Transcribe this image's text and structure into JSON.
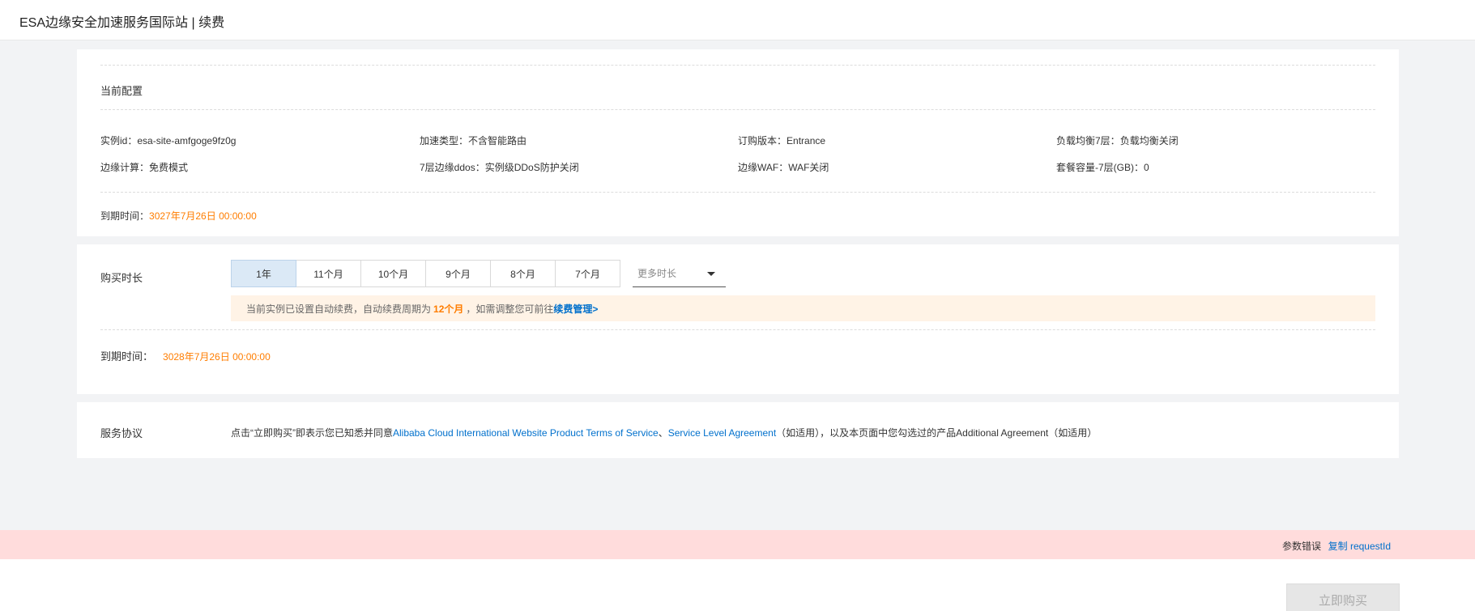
{
  "header": {
    "title": "ESA边缘安全加速服务国际站 | 续费"
  },
  "config": {
    "section_title": "当前配置",
    "items": [
      {
        "key": "实例id：",
        "value": "esa-site-amfgoge9fz0g"
      },
      {
        "key": "加速类型：",
        "value": "不含智能路由"
      },
      {
        "key": "订购版本：",
        "value": "Entrance"
      },
      {
        "key": "负载均衡7层：",
        "value": "负载均衡关闭"
      },
      {
        "key": "边缘计算：",
        "value": "免费模式"
      },
      {
        "key": "7层边缘ddos：",
        "value": "实例级DDoS防护关闭"
      },
      {
        "key": "边缘WAF：",
        "value": "WAF关闭"
      },
      {
        "key": "套餐容量-7层(GB)：",
        "value": "0"
      }
    ],
    "expiry_label": "到期时间：",
    "expiry_value": "3027年7月26日 00:00:00"
  },
  "duration": {
    "label": "购买时长",
    "options": [
      "1年",
      "11个月",
      "10个月",
      "9个月",
      "8个月",
      "7个月"
    ],
    "selected_index": 0,
    "more_placeholder": "更多时长",
    "notice_prefix": "当前实例已设置自动续费，自动续费周期为",
    "notice_period": "12个月",
    "notice_middle": "，如需调整您可前往",
    "notice_link": "续费管理>",
    "expiry_label": "到期时间：",
    "expiry_value": "3028年7月26日 00:00:00"
  },
  "terms": {
    "label": "服务协议",
    "text_prefix": "点击“立即购买”即表示您已知悉并同意",
    "link1": "Alibaba Cloud International Website Product Terms of Service",
    "sep": "、",
    "link2": "Service Level Agreement",
    "text_suffix": "（如适用），以及本页面中您勾选过的产品Additional Agreement（如适用）"
  },
  "error": {
    "message": "参数错误",
    "copy_label": "复制 requestId"
  },
  "footer": {
    "buy_label": "立即购买"
  },
  "colors": {
    "accent_orange": "#ff7d00",
    "link_blue": "#0070cc",
    "error_bg": "#ffdcdc",
    "notice_bg": "#fff3e6"
  }
}
